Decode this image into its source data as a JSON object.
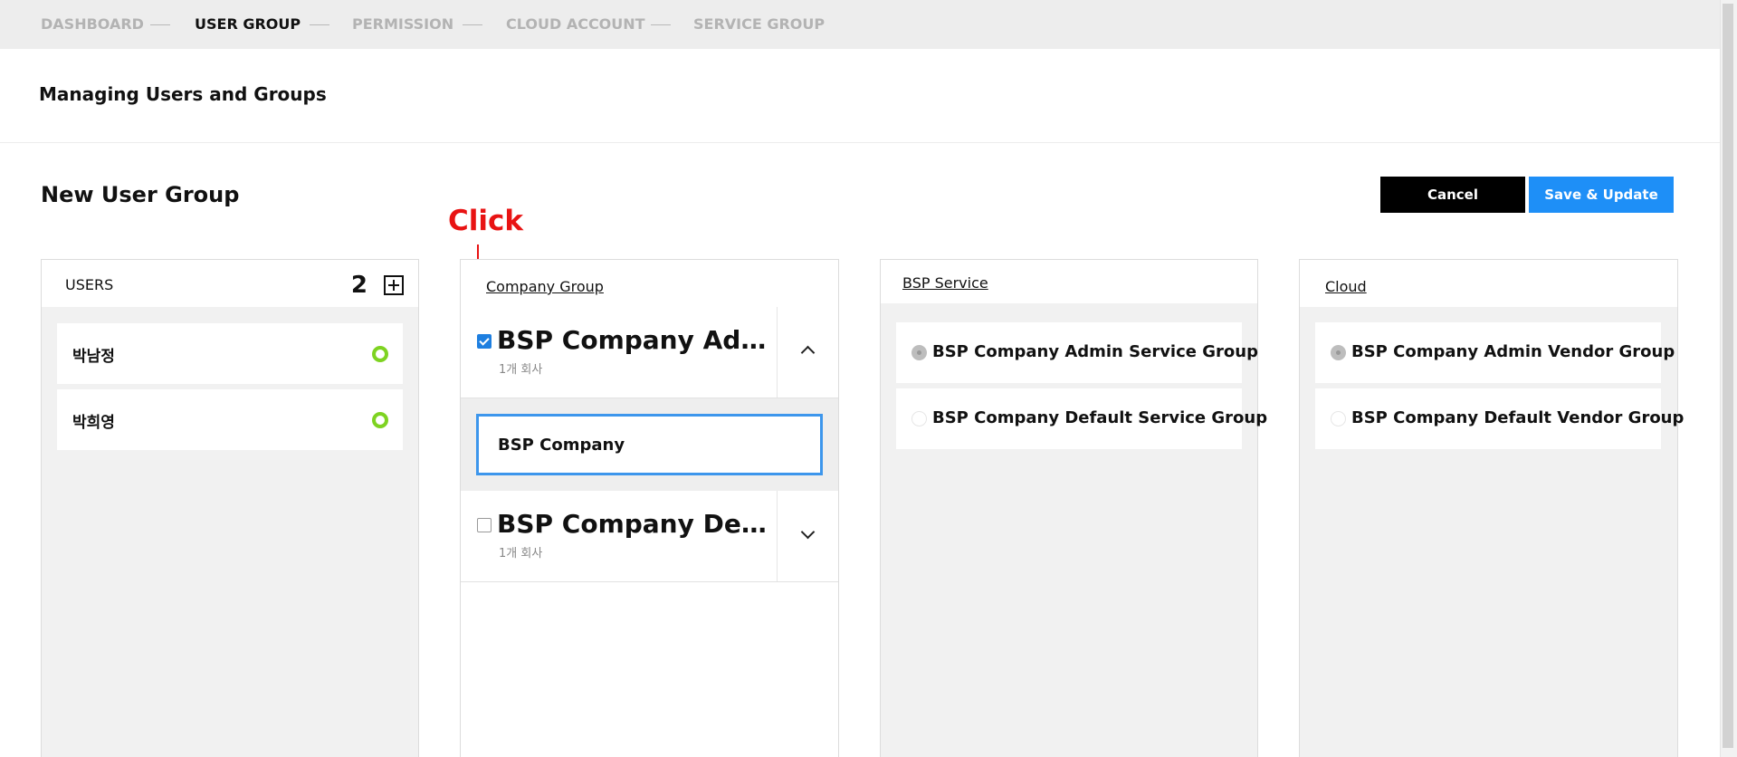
{
  "nav": {
    "items": [
      {
        "label": "DASHBOARD",
        "active": false
      },
      {
        "label": "USER GROUP",
        "active": true
      },
      {
        "label": "PERMISSION",
        "active": false
      },
      {
        "label": "CLOUD ACCOUNT",
        "active": false
      },
      {
        "label": "SERVICE GROUP",
        "active": false
      }
    ]
  },
  "page": {
    "title": "Managing Users and Groups"
  },
  "section": {
    "title": "New User Group",
    "cancel_label": "Cancel",
    "save_label": "Save & Update"
  },
  "annotation": {
    "text": "Click",
    "color": "#e81313"
  },
  "users": {
    "header": "USERS",
    "count": "2",
    "items": [
      {
        "name": "박남정",
        "status": "online"
      },
      {
        "name": "박희영",
        "status": "online"
      }
    ]
  },
  "company_group": {
    "header": "Company Group",
    "groups": [
      {
        "name": "BSP Company Admin Group",
        "sub": "1개 회사",
        "checked": true,
        "expanded": true
      },
      {
        "name": "BSP Company Default Group",
        "sub": "1개 회사",
        "checked": false,
        "expanded": false
      }
    ],
    "expanded_item": "BSP Company"
  },
  "bsp_service": {
    "header": "BSP Service",
    "options": [
      {
        "label": "BSP Company Admin Service Group",
        "selected": true
      },
      {
        "label": "BSP Company Default Service Group",
        "selected": false
      }
    ]
  },
  "cloud": {
    "header": "Cloud",
    "options": [
      {
        "label": "BSP Company Admin Vendor Group",
        "selected": true
      },
      {
        "label": "BSP Company Default Vendor Group",
        "selected": false
      }
    ]
  },
  "colors": {
    "accent": "#1e8ff7",
    "status_online": "#7ed321",
    "selection_border": "#3d96ec"
  }
}
